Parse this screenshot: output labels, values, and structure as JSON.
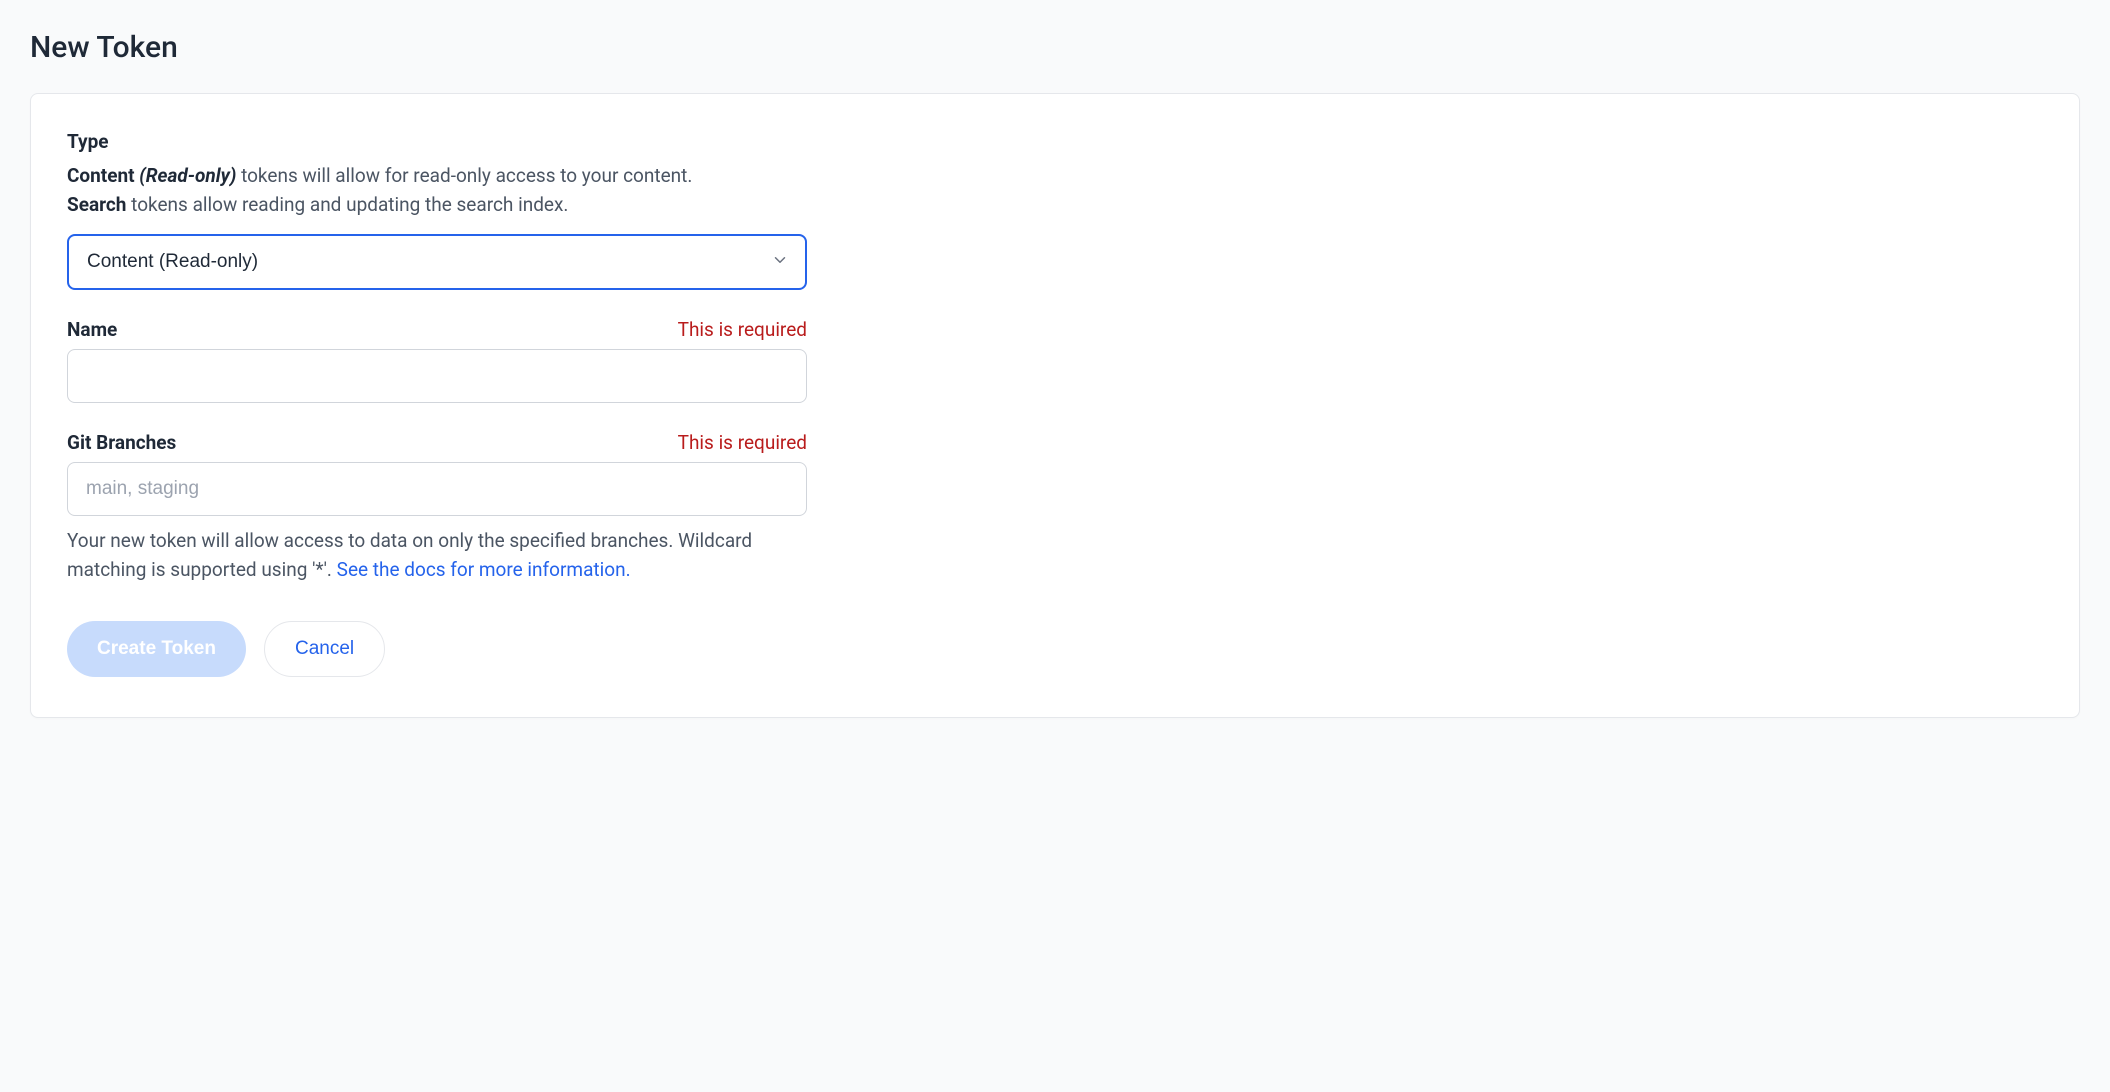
{
  "page": {
    "title": "New Token"
  },
  "fields": {
    "type": {
      "label": "Type",
      "description_content_bold": "Content",
      "description_readonly_bold": "(Read-only)",
      "description_content_rest": " tokens will allow for read-only access to your content.",
      "description_search_bold": "Search",
      "description_search_rest": " tokens allow reading and updating the search index.",
      "selected": "Content (Read-only)"
    },
    "name": {
      "label": "Name",
      "error": "This is required",
      "value": ""
    },
    "branches": {
      "label": "Git Branches",
      "error": "This is required",
      "placeholder": "main, staging",
      "value": "",
      "help_prefix": "Your new token will allow access to data on only the specified branches. Wildcard matching is supported using '*'. ",
      "help_link_text": "See the docs for more information."
    }
  },
  "buttons": {
    "create": "Create Token",
    "cancel": "Cancel"
  }
}
